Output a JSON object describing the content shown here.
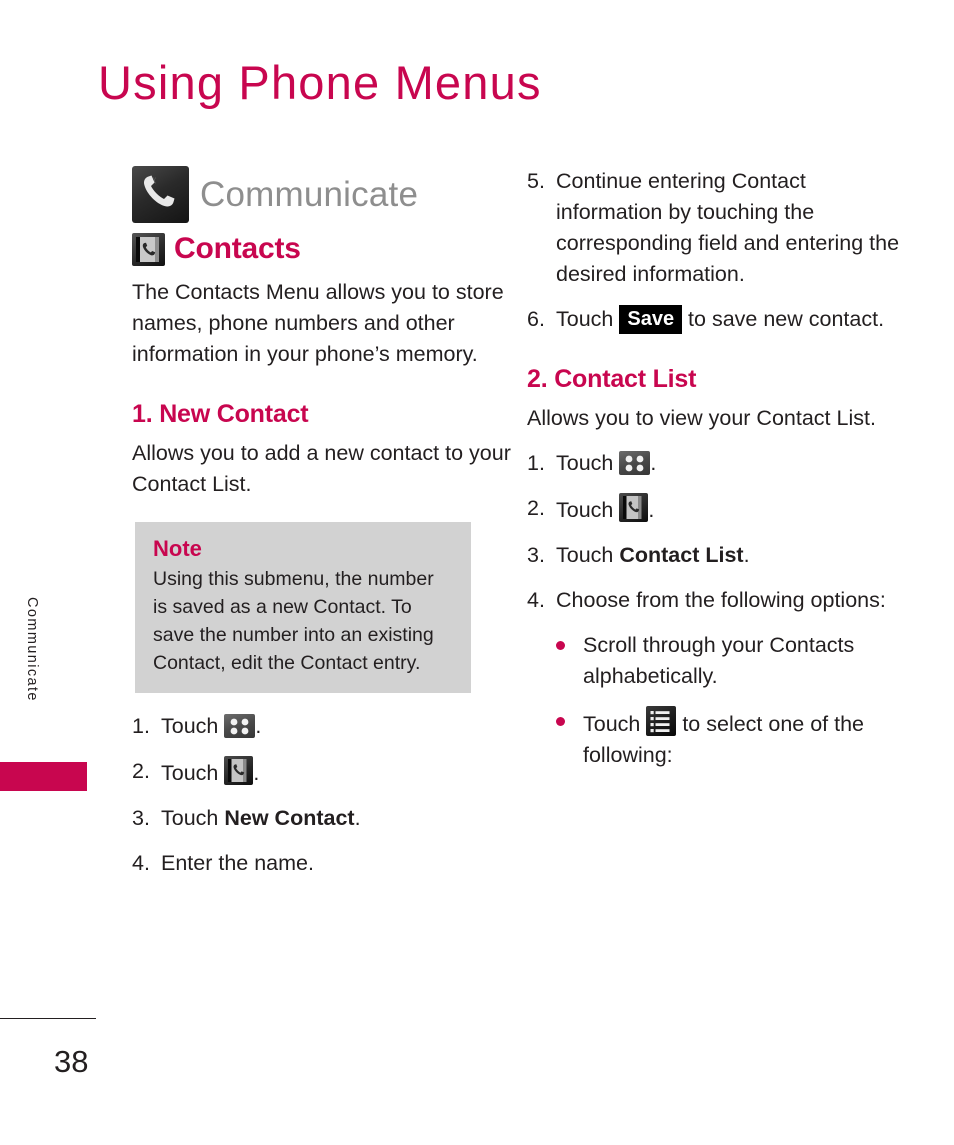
{
  "page": {
    "title": "Using Phone Menus",
    "number": "38",
    "side_tab_label": "Communicate",
    "accent_color": "#c8064f",
    "note_bg_color": "#d2d2d2"
  },
  "left_column": {
    "brand": {
      "icon": "phone-handset-icon",
      "title": "Communicate"
    },
    "section": {
      "icon": "contacts-book-icon",
      "title": "Contacts",
      "intro": "The Contacts Menu allows you to store names, phone numbers and other information in your phone’s memory."
    },
    "subsection": {
      "heading": "1. New Contact",
      "intro": "Allows you to add a new contact to your Contact List.",
      "note": {
        "title": "Note",
        "text": "Using this submenu, the number is saved as a new Contact. To save the number into an existing Contact, edit the Contact entry."
      },
      "steps": [
        {
          "num": "1.",
          "pre": "Touch ",
          "icon": "menu-grid-icon",
          "post": "."
        },
        {
          "num": "2.",
          "pre": "Touch ",
          "icon": "contacts-book-icon",
          "post": "."
        },
        {
          "num": "3.",
          "pre": "Touch ",
          "bold": "New Contact",
          "post": "."
        },
        {
          "num": "4.",
          "pre": "Enter the name.",
          "post": ""
        }
      ]
    }
  },
  "right_column": {
    "continued_steps": [
      {
        "num": "5.",
        "pre": "Continue entering Contact information by touching the corresponding field and entering the desired information.",
        "post": ""
      },
      {
        "num": "6.",
        "pre": "Touch ",
        "chip": "Save",
        "post": " to save new contact."
      }
    ],
    "subsection": {
      "heading": "2. Contact List",
      "intro": "Allows you to view your Contact List.",
      "steps": [
        {
          "num": "1.",
          "pre": "Touch ",
          "icon": "menu-grid-icon",
          "post": "."
        },
        {
          "num": "2.",
          "pre": "Touch ",
          "icon": "contacts-book-icon",
          "post": "."
        },
        {
          "num": "3.",
          "pre": "Touch ",
          "bold": "Contact List",
          "post": "."
        },
        {
          "num": "4.",
          "pre": "Choose from the following options:",
          "post": ""
        }
      ],
      "bullets": [
        {
          "pre": "Scroll through your Contacts alphabetically.",
          "post": ""
        },
        {
          "pre": "Touch ",
          "icon": "list-view-icon",
          "post": " to select one of the following:"
        }
      ]
    }
  }
}
